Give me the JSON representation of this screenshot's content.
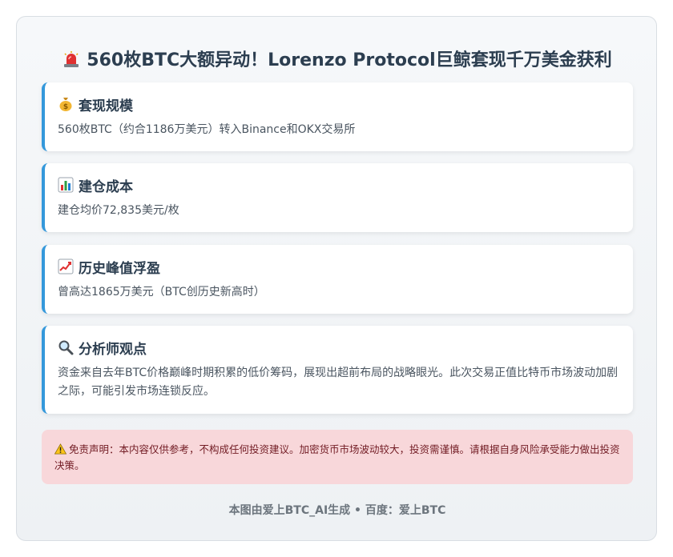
{
  "title": "560枚BTC大额异动！Lorenzo Protocol巨鲸套现千万美金获利",
  "title_icon": "siren-icon",
  "accent_color": "#3498db",
  "cards": [
    {
      "icon": "money-bag-icon",
      "heading": "套现规模",
      "body": "560枚BTC（约合1186万美元）转入Binance和OKX交易所"
    },
    {
      "icon": "bar-chart-icon",
      "heading": "建仓成本",
      "body": "建仓均价72,835美元/枚"
    },
    {
      "icon": "trend-up-icon",
      "heading": "历史峰值浮盈",
      "body": "曾高达1865万美元（BTC创历史新高时）"
    },
    {
      "icon": "magnifier-icon",
      "heading": "分析师观点",
      "body": "资金来自去年BTC价格巅峰时期积累的低价筹码，展现出超前布局的战略眼光。此次交易正值比特币市场波动加剧之际，可能引发市场连锁反应。"
    }
  ],
  "disclaimer": {
    "icon": "warning-icon",
    "text": "免责声明：本内容仅供参考，不构成任何投资建议。加密货币市场波动较大，投资需谨慎。请根据自身风险承受能力做出投资决策。",
    "bg_color": "#f8d7da",
    "text_color": "#721c24"
  },
  "footer": "本图由爱上BTC_AI生成 • 百度：爱上BTC"
}
